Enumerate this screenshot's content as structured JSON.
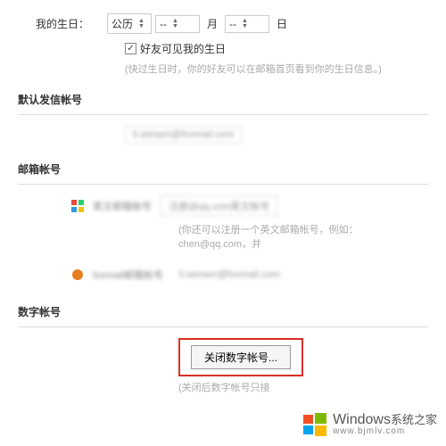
{
  "birthday": {
    "label": "我的生日：",
    "calendar": "公历",
    "month": "--",
    "month_unit": "月",
    "day": "--",
    "day_unit": "日",
    "checkbox_label": "好友可见我的生日",
    "checkbox_checked": true,
    "hint": "(快过生日时，你的好友可以在邮箱首页看到你的生日信息。)"
  },
  "default_account": {
    "title": "默认发信帐号",
    "value": "li.sensen@foxmail.com"
  },
  "mailbox_account": {
    "title": "邮箱帐号",
    "qq_label": "英文邮箱帐号",
    "qq_value": "注册@qq.com英文帐号",
    "qq_hint": "(你还可以注册一个英文邮箱帐号，例如：chen@qq.com，并",
    "foxmail_label": "foxmail邮箱帐号",
    "foxmail_value": "li.sensen@foxmail.com"
  },
  "digital_account": {
    "title": "数字帐号",
    "button_label": "关闭数字帐号...",
    "hint": "(关闭后数字帐号只接"
  },
  "watermark": {
    "main": "Windows",
    "sub": "系统之家",
    "url": "www.bjmlv.com"
  }
}
